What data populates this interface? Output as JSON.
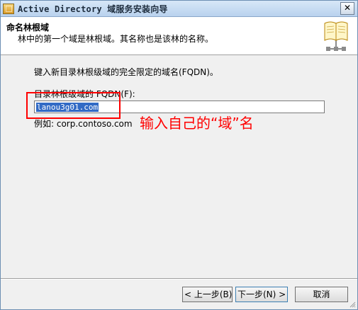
{
  "window": {
    "title": "Active Directory 域服务安装向导",
    "close_label": "✕"
  },
  "header": {
    "title": "命名林根域",
    "subtitle": "林中的第一个域是林根域。其名称也是该林的名称。"
  },
  "main": {
    "intro_text": "键入新目录林根级域的完全限定的域名(FQDN)。",
    "field_label": "目录林根级域的 FQDN(F):",
    "domain_value": "lanou3g01.com",
    "example_text": "例如: corp.contoso.com"
  },
  "annotation": {
    "text": "输入自己的“域”名",
    "color": "#ff0000"
  },
  "buttons": {
    "back": "< 上一步(B)",
    "next": "下一步(N) >",
    "cancel": "取消"
  }
}
